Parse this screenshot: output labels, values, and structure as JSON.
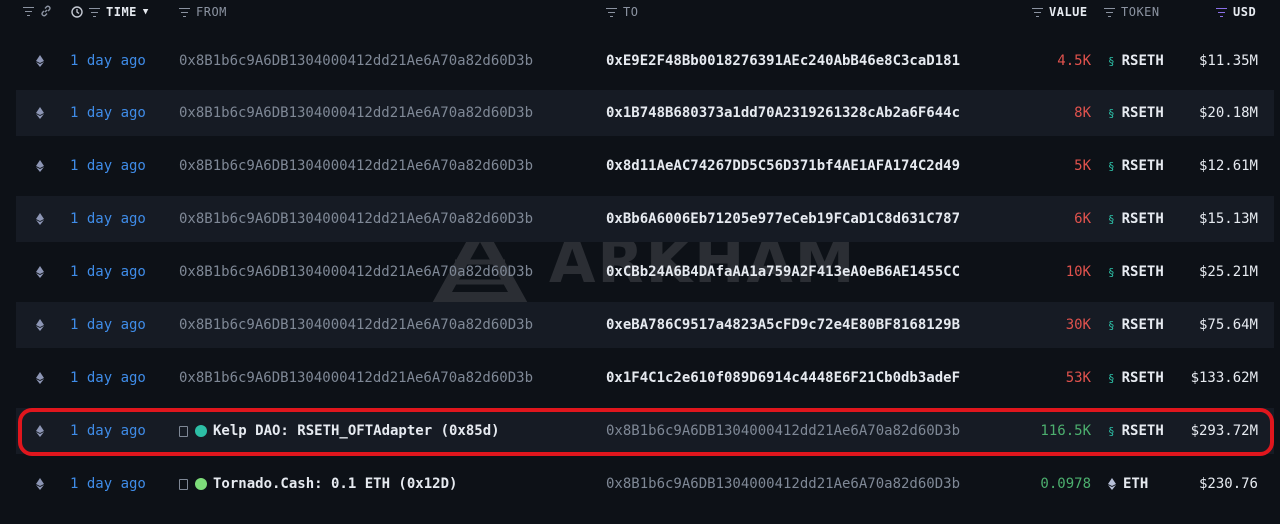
{
  "headers": {
    "time": "TIME",
    "from": "FROM",
    "to": "TO",
    "value": "VALUE",
    "token": "TOKEN",
    "usd": "USD"
  },
  "watermark": "ARKHAM",
  "colors": {
    "time": "#3f8ce8",
    "value_out": "#e0524d",
    "value_in": "#4caf6e",
    "highlight": "#e0161d",
    "usd_filter": "#8a6fe8"
  },
  "rows": [
    {
      "time": "1 day ago",
      "from": "0x8B1b6c9A6DB1304000412dd21Ae6A70a82d60D3b",
      "to": "0xE9E2F48Bb0018276391AEc240AbB46e8C3caD181",
      "value": "4.5K",
      "direction": "out",
      "token": "RSETH",
      "usd": "$11.35M"
    },
    {
      "time": "1 day ago",
      "from": "0x8B1b6c9A6DB1304000412dd21Ae6A70a82d60D3b",
      "to": "0x1B748B680373a1dd70A2319261328cAb2a6F644c",
      "value": "8K",
      "direction": "out",
      "token": "RSETH",
      "usd": "$20.18M"
    },
    {
      "time": "1 day ago",
      "from": "0x8B1b6c9A6DB1304000412dd21Ae6A70a82d60D3b",
      "to": "0x8d11AeAC74267DD5C56D371bf4AE1AFA174C2d49",
      "value": "5K",
      "direction": "out",
      "token": "RSETH",
      "usd": "$12.61M"
    },
    {
      "time": "1 day ago",
      "from": "0x8B1b6c9A6DB1304000412dd21Ae6A70a82d60D3b",
      "to": "0xBb6A6006Eb71205e977eCeb19FCaD1C8d631C787",
      "value": "6K",
      "direction": "out",
      "token": "RSETH",
      "usd": "$15.13M"
    },
    {
      "time": "1 day ago",
      "from": "0x8B1b6c9A6DB1304000412dd21Ae6A70a82d60D3b",
      "to": "0xCBb24A6B4DAfaAA1a759A2F413eA0eB6AE1455CC",
      "value": "10K",
      "direction": "out",
      "token": "RSETH",
      "usd": "$25.21M"
    },
    {
      "time": "1 day ago",
      "from": "0x8B1b6c9A6DB1304000412dd21Ae6A70a82d60D3b",
      "to": "0xeBA786C9517a4823A5cFD9c72e4E80BF8168129B",
      "value": "30K",
      "direction": "out",
      "token": "RSETH",
      "usd": "$75.64M"
    },
    {
      "time": "1 day ago",
      "from": "0x8B1b6c9A6DB1304000412dd21Ae6A70a82d60D3b",
      "to": "0x1F4C1c2e610f089D6914c4448E6F21Cb0db3adeF",
      "value": "53K",
      "direction": "out",
      "token": "RSETH",
      "usd": "$133.62M"
    },
    {
      "time": "1 day ago",
      "from": "Kelp DAO: RSETH_OFTAdapter (0x85d)",
      "from_is_entity": true,
      "from_icon": "kelp-dao-icon",
      "to": "0x8B1b6c9A6DB1304000412dd21Ae6A70a82d60D3b",
      "value": "116.5K",
      "direction": "in",
      "token": "RSETH",
      "usd": "$293.72M",
      "highlighted": true
    },
    {
      "time": "1 day ago",
      "from": "Tornado.Cash: 0.1 ETH (0x12D)",
      "from_is_entity": true,
      "from_icon": "tornado-cash-icon",
      "to": "0x8B1b6c9A6DB1304000412dd21Ae6A70a82d60D3b",
      "value": "0.0978",
      "direction": "in",
      "token": "ETH",
      "usd": "$230.76"
    }
  ]
}
